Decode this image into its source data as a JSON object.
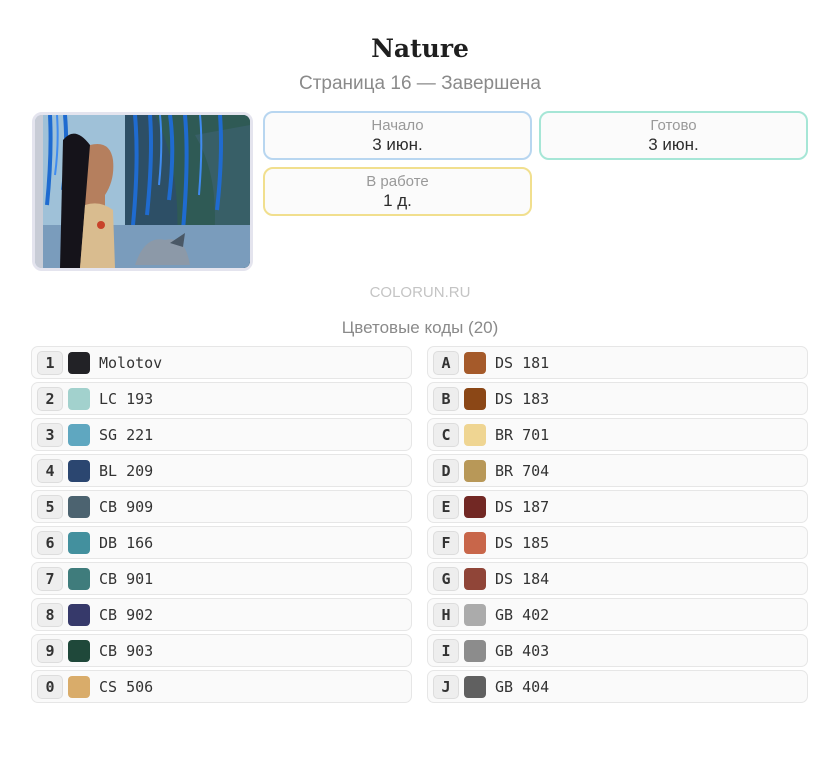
{
  "header": {
    "title": "Nature",
    "subtitle": "Страница 16 — Завершена"
  },
  "stats": {
    "start": {
      "label": "Начало",
      "value": "3 июн."
    },
    "done": {
      "label": "Готово",
      "value": "3 июн."
    },
    "in_work": {
      "label": "В работе",
      "value": "1 д."
    }
  },
  "watermark": "COLORUN.RU",
  "codes": {
    "title": "Цветовые коды (20)",
    "left": [
      {
        "key": "1",
        "color": "#222226",
        "code": "Molotov"
      },
      {
        "key": "2",
        "color": "#a2d1cd",
        "code": "LC 193"
      },
      {
        "key": "3",
        "color": "#5fa7c0",
        "code": "SG 221"
      },
      {
        "key": "4",
        "color": "#2b4670",
        "code": "BL 209"
      },
      {
        "key": "5",
        "color": "#4c6370",
        "code": "CB 909"
      },
      {
        "key": "6",
        "color": "#43909e",
        "code": "DB 166"
      },
      {
        "key": "7",
        "color": "#3f7c7c",
        "code": "CB 901"
      },
      {
        "key": "8",
        "color": "#36396a",
        "code": "CB 902"
      },
      {
        "key": "9",
        "color": "#1f483a",
        "code": "CB 903"
      },
      {
        "key": "0",
        "color": "#d9ac6a",
        "code": "CS 506"
      }
    ],
    "right": [
      {
        "key": "A",
        "color": "#a55a2a",
        "code": "DS 181"
      },
      {
        "key": "B",
        "color": "#8b4716",
        "code": "DS 183"
      },
      {
        "key": "C",
        "color": "#efd592",
        "code": "BR 701"
      },
      {
        "key": "D",
        "color": "#b89858",
        "code": "BR 704"
      },
      {
        "key": "E",
        "color": "#722824",
        "code": "DS 187"
      },
      {
        "key": "F",
        "color": "#c8664a",
        "code": "DS 185"
      },
      {
        "key": "G",
        "color": "#904538",
        "code": "DS 184"
      },
      {
        "key": "H",
        "color": "#ababab",
        "code": "GB 402"
      },
      {
        "key": "I",
        "color": "#8c8c8c",
        "code": "GB 403"
      },
      {
        "key": "J",
        "color": "#606060",
        "code": "GB 404"
      }
    ]
  }
}
